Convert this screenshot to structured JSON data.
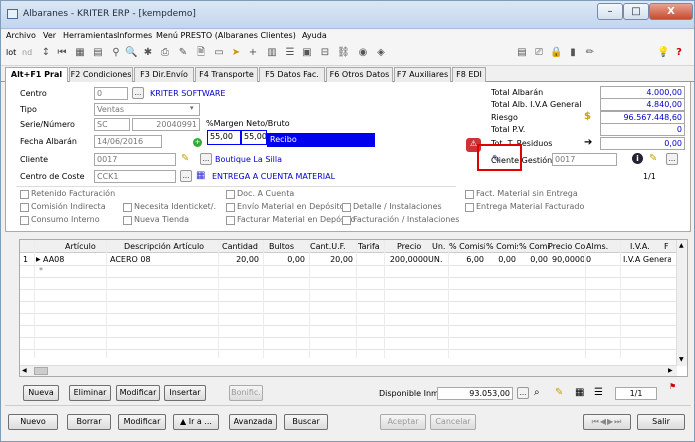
{
  "window": {
    "title": "Albaranes - KRITER ERP - [kempdemo]",
    "controls": [
      "–",
      "□",
      "X"
    ]
  },
  "menu": [
    "Archivo",
    "Ver",
    "Herramientas",
    "Informes",
    "Menú PRESTO (Albaranes Clientes)",
    "Ayuda"
  ],
  "toolbar": {
    "lot": "lot",
    "nd": "nd"
  },
  "tabs": [
    "Alt+F1 Pral",
    "F2 Condiciones",
    "F3 Dir.Envío",
    "F4 Transporte",
    "F5 Datos Fac.",
    "F6 Otros Datos",
    "F7 Auxiliares",
    "F8 EDI"
  ],
  "form": {
    "centro_label": "Centro",
    "centro_value": "0",
    "centro_name": "KRITER SOFTWARE",
    "tipo_label": "Tipo",
    "tipo_value": "Ventas",
    "serie_label": "Serie/Número",
    "serie_value": "SC",
    "numero_value": "20040991",
    "margen_label": "%Margen Neto/Bruto",
    "margen_neto": "55,00",
    "margen_bruto": "55,00",
    "estado": "Recibo",
    "fecha_label": "Fecha Albarán",
    "fecha_value": "14/06/2016",
    "cliente_label": "Cliente",
    "cliente_value": "0017",
    "cliente_name": "Boutique La Silla",
    "coste_label": "Centro de Coste",
    "coste_value": "CCK1",
    "coste_name": "ENTREGA A CUENTA MATERIAL"
  },
  "totals": [
    {
      "label": "Total Albarán",
      "value": "4.000,00"
    },
    {
      "label": "Total Alb. I.V.A General",
      "value": "4.840,00"
    },
    {
      "label": "Riesgo",
      "value": "96.567.448,60"
    },
    {
      "label": "Total P.V.",
      "value": "0"
    },
    {
      "label": "Tot. T. Residuos",
      "value": "0,00"
    }
  ],
  "cliente_gestion": {
    "label": "Cliente Gestión",
    "value": "0017",
    "page": "1/1"
  },
  "checkboxes": {
    "col1": [
      "Retenido Facturación",
      "Comisión Indirecta",
      "Consumo Interno"
    ],
    "col2": [
      "Necesita Identicket/.",
      "Nueva Tienda"
    ],
    "col3": [
      "Doc. A Cuenta",
      "Envío Material en Depósito",
      "Facturar Material en Depósito"
    ],
    "col4": [
      "Detalle / Instalaciones",
      "Facturación / Instalaciones"
    ],
    "col5": [
      "Fact. Material sin Entrega",
      "Entrega Material Facturado"
    ]
  },
  "grid": {
    "headers": [
      "Artículo",
      "Descripción Artículo",
      "Cantidad",
      "Bultos",
      "Cant.U.F.",
      "Tarifa",
      "Precio",
      "Un.",
      "% Comisió",
      "% Comis.",
      "% Comis.",
      "Precio Cost",
      "Alms.",
      "I.V.A.",
      "F"
    ],
    "rows": [
      {
        "n": "1",
        "articulo": "AA08",
        "descripcion": "ACERO 08",
        "cantidad": "20,00",
        "bultos": "0,00",
        "cantuf": "20,00",
        "tarifa": "",
        "precio": "200,0000",
        "un": "UN.",
        "com1": "6,00",
        "com2": "0,00",
        "com3": "0,00",
        "coste": "90,0000",
        "alm": "0",
        "iva": "I.V.A General"
      }
    ],
    "new_row": "*"
  },
  "line_buttons": [
    "Nueva",
    "Eliminar",
    "Modificar",
    "Insertar",
    "Bonific."
  ],
  "disponible": {
    "label": "Disponible Inmo",
    "value": "93.053,00",
    "page": "1/1"
  },
  "bottom_buttons": [
    "Nuevo",
    "Borrar",
    "Modificar",
    "▲ Ir a ...",
    "Avanzada",
    "Buscar",
    "Aceptar",
    "Cancelar",
    "Salir"
  ],
  "colors": {
    "accent_blue": "#0000ee",
    "highlight_red": "#e00000",
    "link_blue": "#0000cc"
  }
}
